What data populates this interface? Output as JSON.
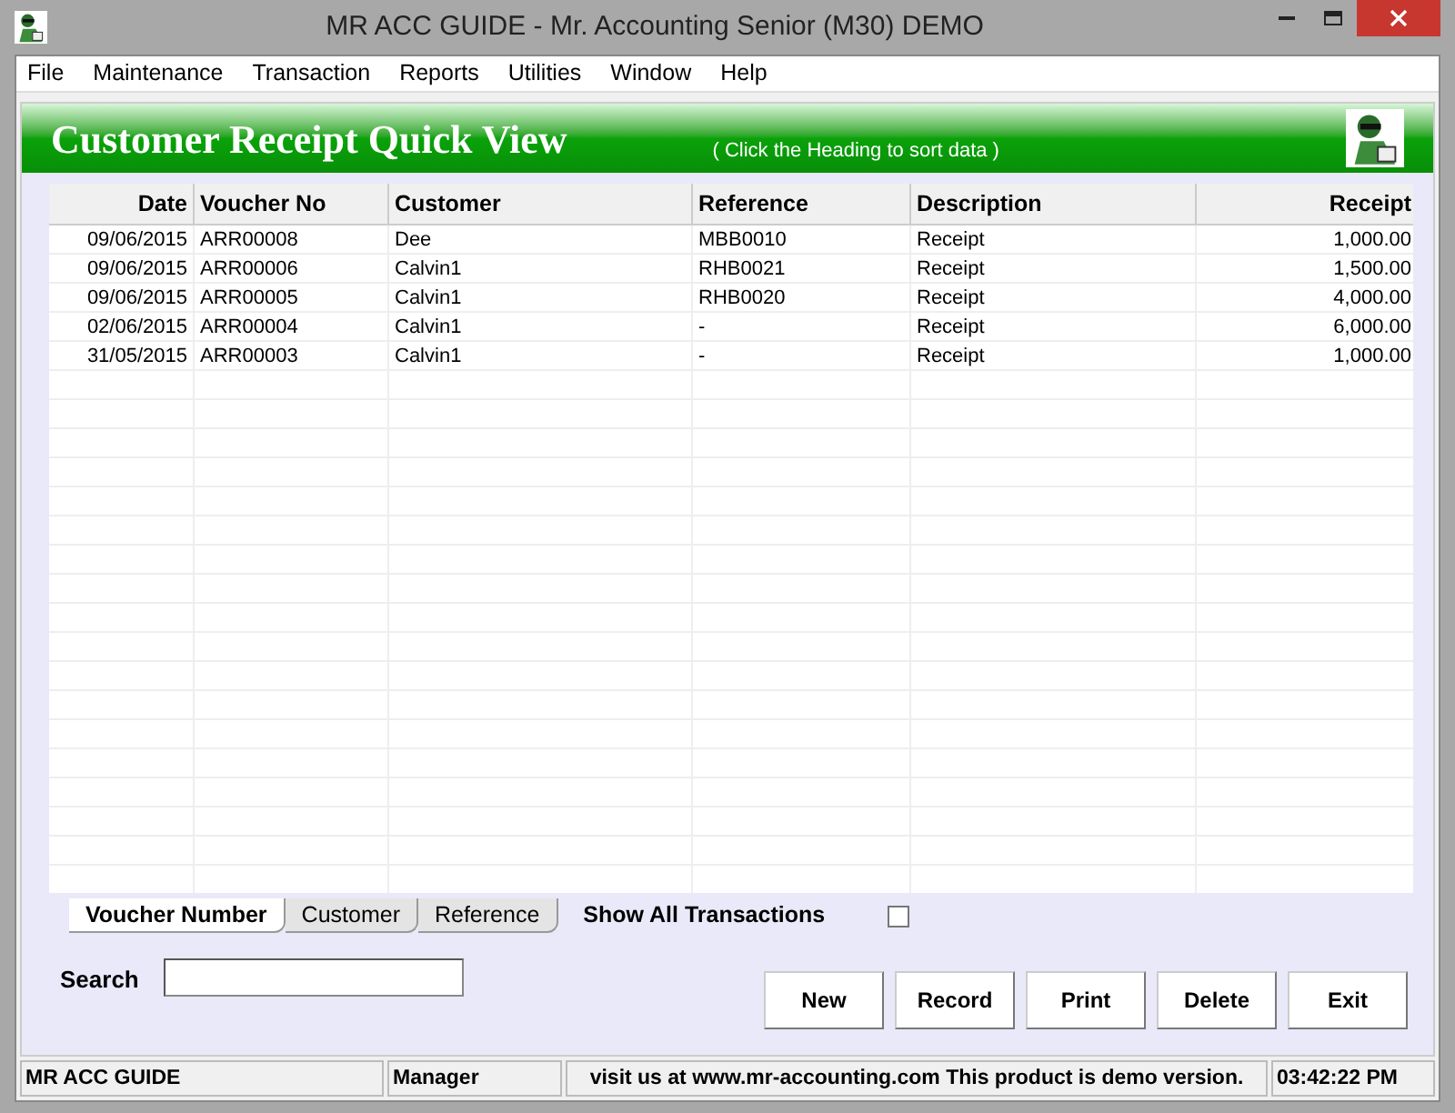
{
  "window": {
    "title": "MR ACC GUIDE - Mr. Accounting Senior (M30) DEMO"
  },
  "menu": [
    "File",
    "Maintenance",
    "Transaction",
    "Reports",
    "Utilities",
    "Window",
    "Help"
  ],
  "header": {
    "title": "Customer Receipt Quick View",
    "hint": "( Click the Heading to sort data )"
  },
  "table": {
    "columns": [
      "Date",
      "Voucher No",
      "Customer",
      "Reference",
      "Description",
      "Receipt"
    ],
    "rows": [
      [
        "09/06/2015",
        "ARR00008",
        "Dee",
        "MBB0010",
        "Receipt",
        "1,000.00"
      ],
      [
        "09/06/2015",
        "ARR00006",
        "Calvin1",
        "RHB0021",
        "Receipt",
        "1,500.00"
      ],
      [
        "09/06/2015",
        "ARR00005",
        "Calvin1",
        "RHB0020",
        "Receipt",
        "4,000.00"
      ],
      [
        "02/06/2015",
        "ARR00004",
        "Calvin1",
        "-",
        "Receipt",
        "6,000.00"
      ],
      [
        "31/05/2015",
        "ARR00003",
        "Calvin1",
        "-",
        "Receipt",
        "1,000.00"
      ]
    ]
  },
  "sort_tabs": [
    {
      "label": "Voucher Number",
      "selected": true
    },
    {
      "label": "Customer",
      "selected": false
    },
    {
      "label": "Reference",
      "selected": false
    }
  ],
  "show_all": {
    "label": "Show All Transactions",
    "checked": false
  },
  "search": {
    "label": "Search"
  },
  "buttons": [
    "New",
    "Record",
    "Print",
    "Delete",
    "Exit"
  ],
  "status_bar": [
    "MR ACC GUIDE",
    "Manager",
    "visit us at www.mr-accounting.com This product is demo version.",
    "03:42:22 PM"
  ]
}
